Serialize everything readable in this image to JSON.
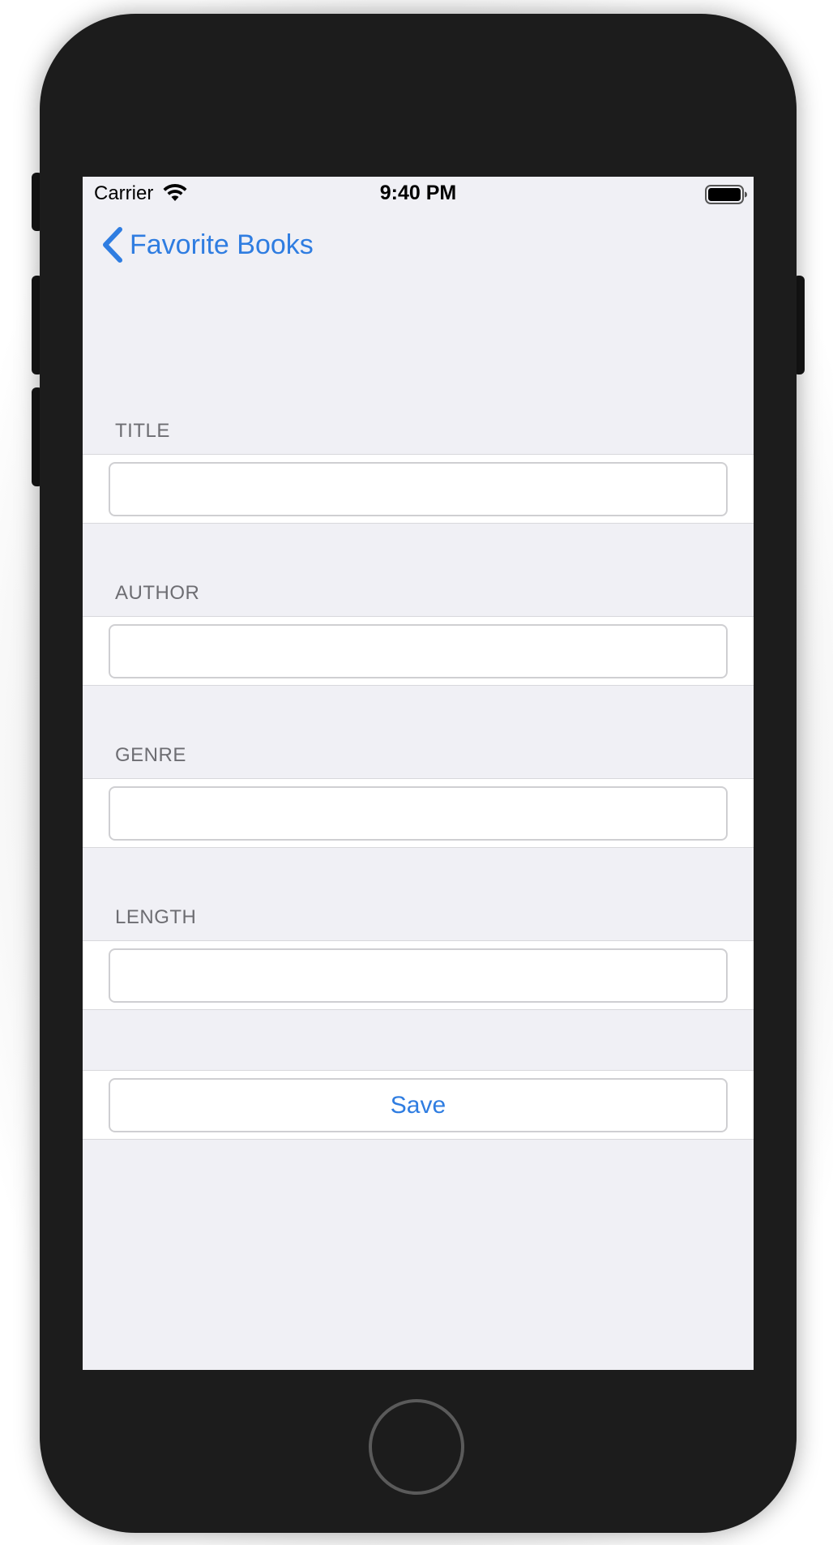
{
  "status_bar": {
    "carrier": "Carrier",
    "time": "9:40 PM",
    "wifi_icon": "wifi-icon",
    "battery_icon": "battery-full-icon"
  },
  "nav": {
    "back_label": "Favorite Books",
    "back_icon": "chevron-left-icon"
  },
  "form": {
    "title_header": "TITLE",
    "title_value": "",
    "author_header": "AUTHOR",
    "author_value": "",
    "genre_header": "GENRE",
    "genre_value": "",
    "length_header": "LENGTH",
    "length_value": "",
    "save_label": "Save"
  },
  "colors": {
    "accent": "#2f7de1",
    "background": "#f0f0f5",
    "header_text": "#6d6d72"
  }
}
